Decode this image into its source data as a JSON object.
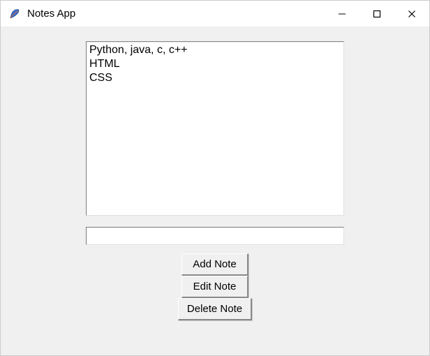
{
  "window": {
    "title": "Notes App",
    "icon": "feather-icon"
  },
  "notes": {
    "items": [
      "Python, java, c, c++",
      "HTML",
      "CSS"
    ]
  },
  "entry": {
    "value": "",
    "placeholder": ""
  },
  "buttons": {
    "add": "Add Note",
    "edit": "Edit Note",
    "delete": "Delete Note"
  }
}
